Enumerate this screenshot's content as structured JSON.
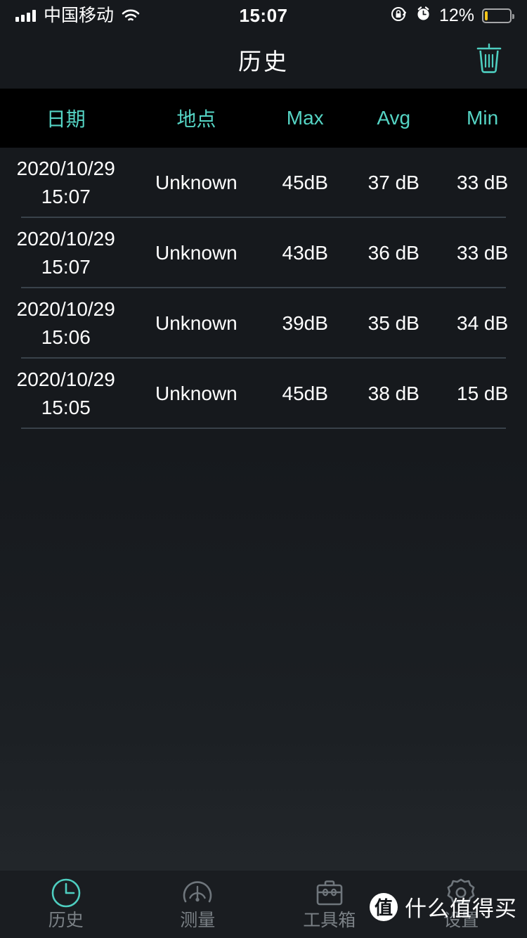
{
  "status_bar": {
    "carrier": "中国移动",
    "time": "15:07",
    "battery_percent_label": "12%",
    "battery_level": 12,
    "battery_color": "#f5c518",
    "signal_icon": "cellular-bars-icon",
    "wifi_icon": "wifi-icon",
    "rotation_lock_icon": "rotation-lock-icon",
    "alarm_icon": "alarm-clock-icon"
  },
  "nav_bar": {
    "title": "历史",
    "delete_icon": "trash-icon",
    "accent_color": "#4ecec0"
  },
  "table": {
    "columns": [
      "日期",
      "地点",
      "Max",
      "Avg",
      "Min"
    ],
    "header_color": "#55d4c4",
    "rows": [
      {
        "date": "2020/10/29",
        "time": "15:07",
        "location": "Unknown",
        "max": "45dB",
        "avg": "37 dB",
        "min": "33 dB"
      },
      {
        "date": "2020/10/29",
        "time": "15:07",
        "location": "Unknown",
        "max": "43dB",
        "avg": "36 dB",
        "min": "33 dB"
      },
      {
        "date": "2020/10/29",
        "time": "15:06",
        "location": "Unknown",
        "max": "39dB",
        "avg": "35 dB",
        "min": "34 dB"
      },
      {
        "date": "2020/10/29",
        "time": "15:05",
        "location": "Unknown",
        "max": "45dB",
        "avg": "38 dB",
        "min": "15 dB"
      }
    ]
  },
  "tab_bar": {
    "active_index": 0,
    "active_color": "#4ecec0",
    "inactive_color": "#7b8186",
    "tabs": [
      {
        "label": "历史",
        "icon": "clock-icon"
      },
      {
        "label": "测量",
        "icon": "gauge-icon"
      },
      {
        "label": "工具箱",
        "icon": "briefcase-icon"
      },
      {
        "label": "设置",
        "icon": "gear-icon"
      }
    ]
  },
  "watermark": {
    "badge": "值",
    "text": "什么值得买"
  }
}
